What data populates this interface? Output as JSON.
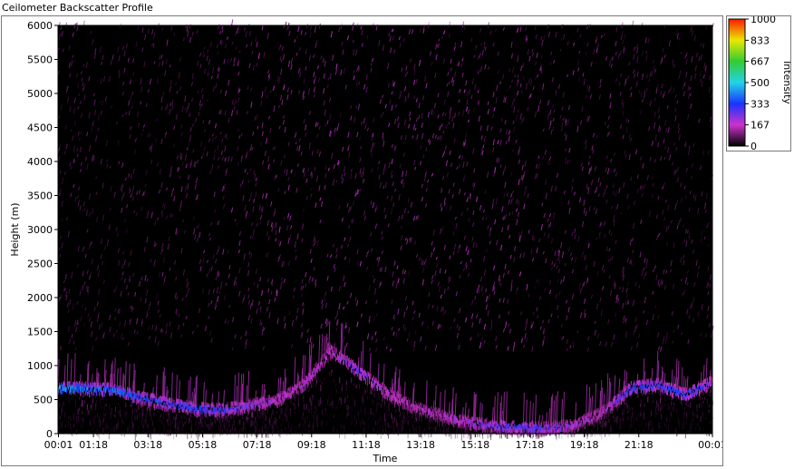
{
  "window": {
    "title": "Ceilometer Backscatter Profile"
  },
  "colors": {
    "background": "#000000",
    "magenta": "#cc33cc",
    "blue": "#1a33ff",
    "cyan": "#22d4e6",
    "green": "#33cc33",
    "yellow": "#e8e800",
    "red": "#ff1a00"
  },
  "chart_data": {
    "type": "heatmap",
    "title": "Ceilometer Backscatter Profile",
    "xlabel": "Time",
    "ylabel": "Height (m)",
    "xlim": [
      "00:01",
      "00:01"
    ],
    "x_ticks": [
      "00:01",
      "01:18",
      "03:18",
      "05:18",
      "07:18",
      "09:18",
      "11:18",
      "13:18",
      "15:18",
      "17:18",
      "19:18",
      "21:18",
      "00:01"
    ],
    "x_tick_hours": [
      0.017,
      1.3,
      3.3,
      5.3,
      7.3,
      9.3,
      11.3,
      13.3,
      15.3,
      17.3,
      19.3,
      21.3,
      24.0
    ],
    "ylim": [
      0,
      6000
    ],
    "y_ticks": [
      0,
      500,
      1000,
      1500,
      2000,
      2500,
      3000,
      3500,
      4000,
      4500,
      5000,
      5500,
      6000
    ],
    "colorbar": {
      "label": "Intensity",
      "range": [
        0,
        1000
      ],
      "ticks": [
        0,
        167,
        333,
        500,
        667,
        833,
        1000
      ]
    },
    "cloud_base_layer": {
      "hours": [
        0,
        1,
        2,
        3,
        4,
        5,
        6,
        7,
        8,
        9,
        10,
        11,
        12,
        13,
        14,
        15,
        16,
        17,
        18,
        19,
        20,
        21,
        22,
        23,
        24
      ],
      "height_m": [
        700,
        690,
        680,
        560,
        470,
        400,
        380,
        440,
        520,
        750,
        1250,
        950,
        650,
        420,
        300,
        200,
        140,
        120,
        110,
        160,
        350,
        700,
        750,
        600,
        800
      ],
      "peak_intensity": [
        430,
        420,
        380,
        340,
        320,
        330,
        300,
        220,
        180,
        160,
        180,
        260,
        160,
        130,
        150,
        200,
        250,
        280,
        260,
        180,
        150,
        340,
        300,
        350,
        200
      ]
    }
  }
}
